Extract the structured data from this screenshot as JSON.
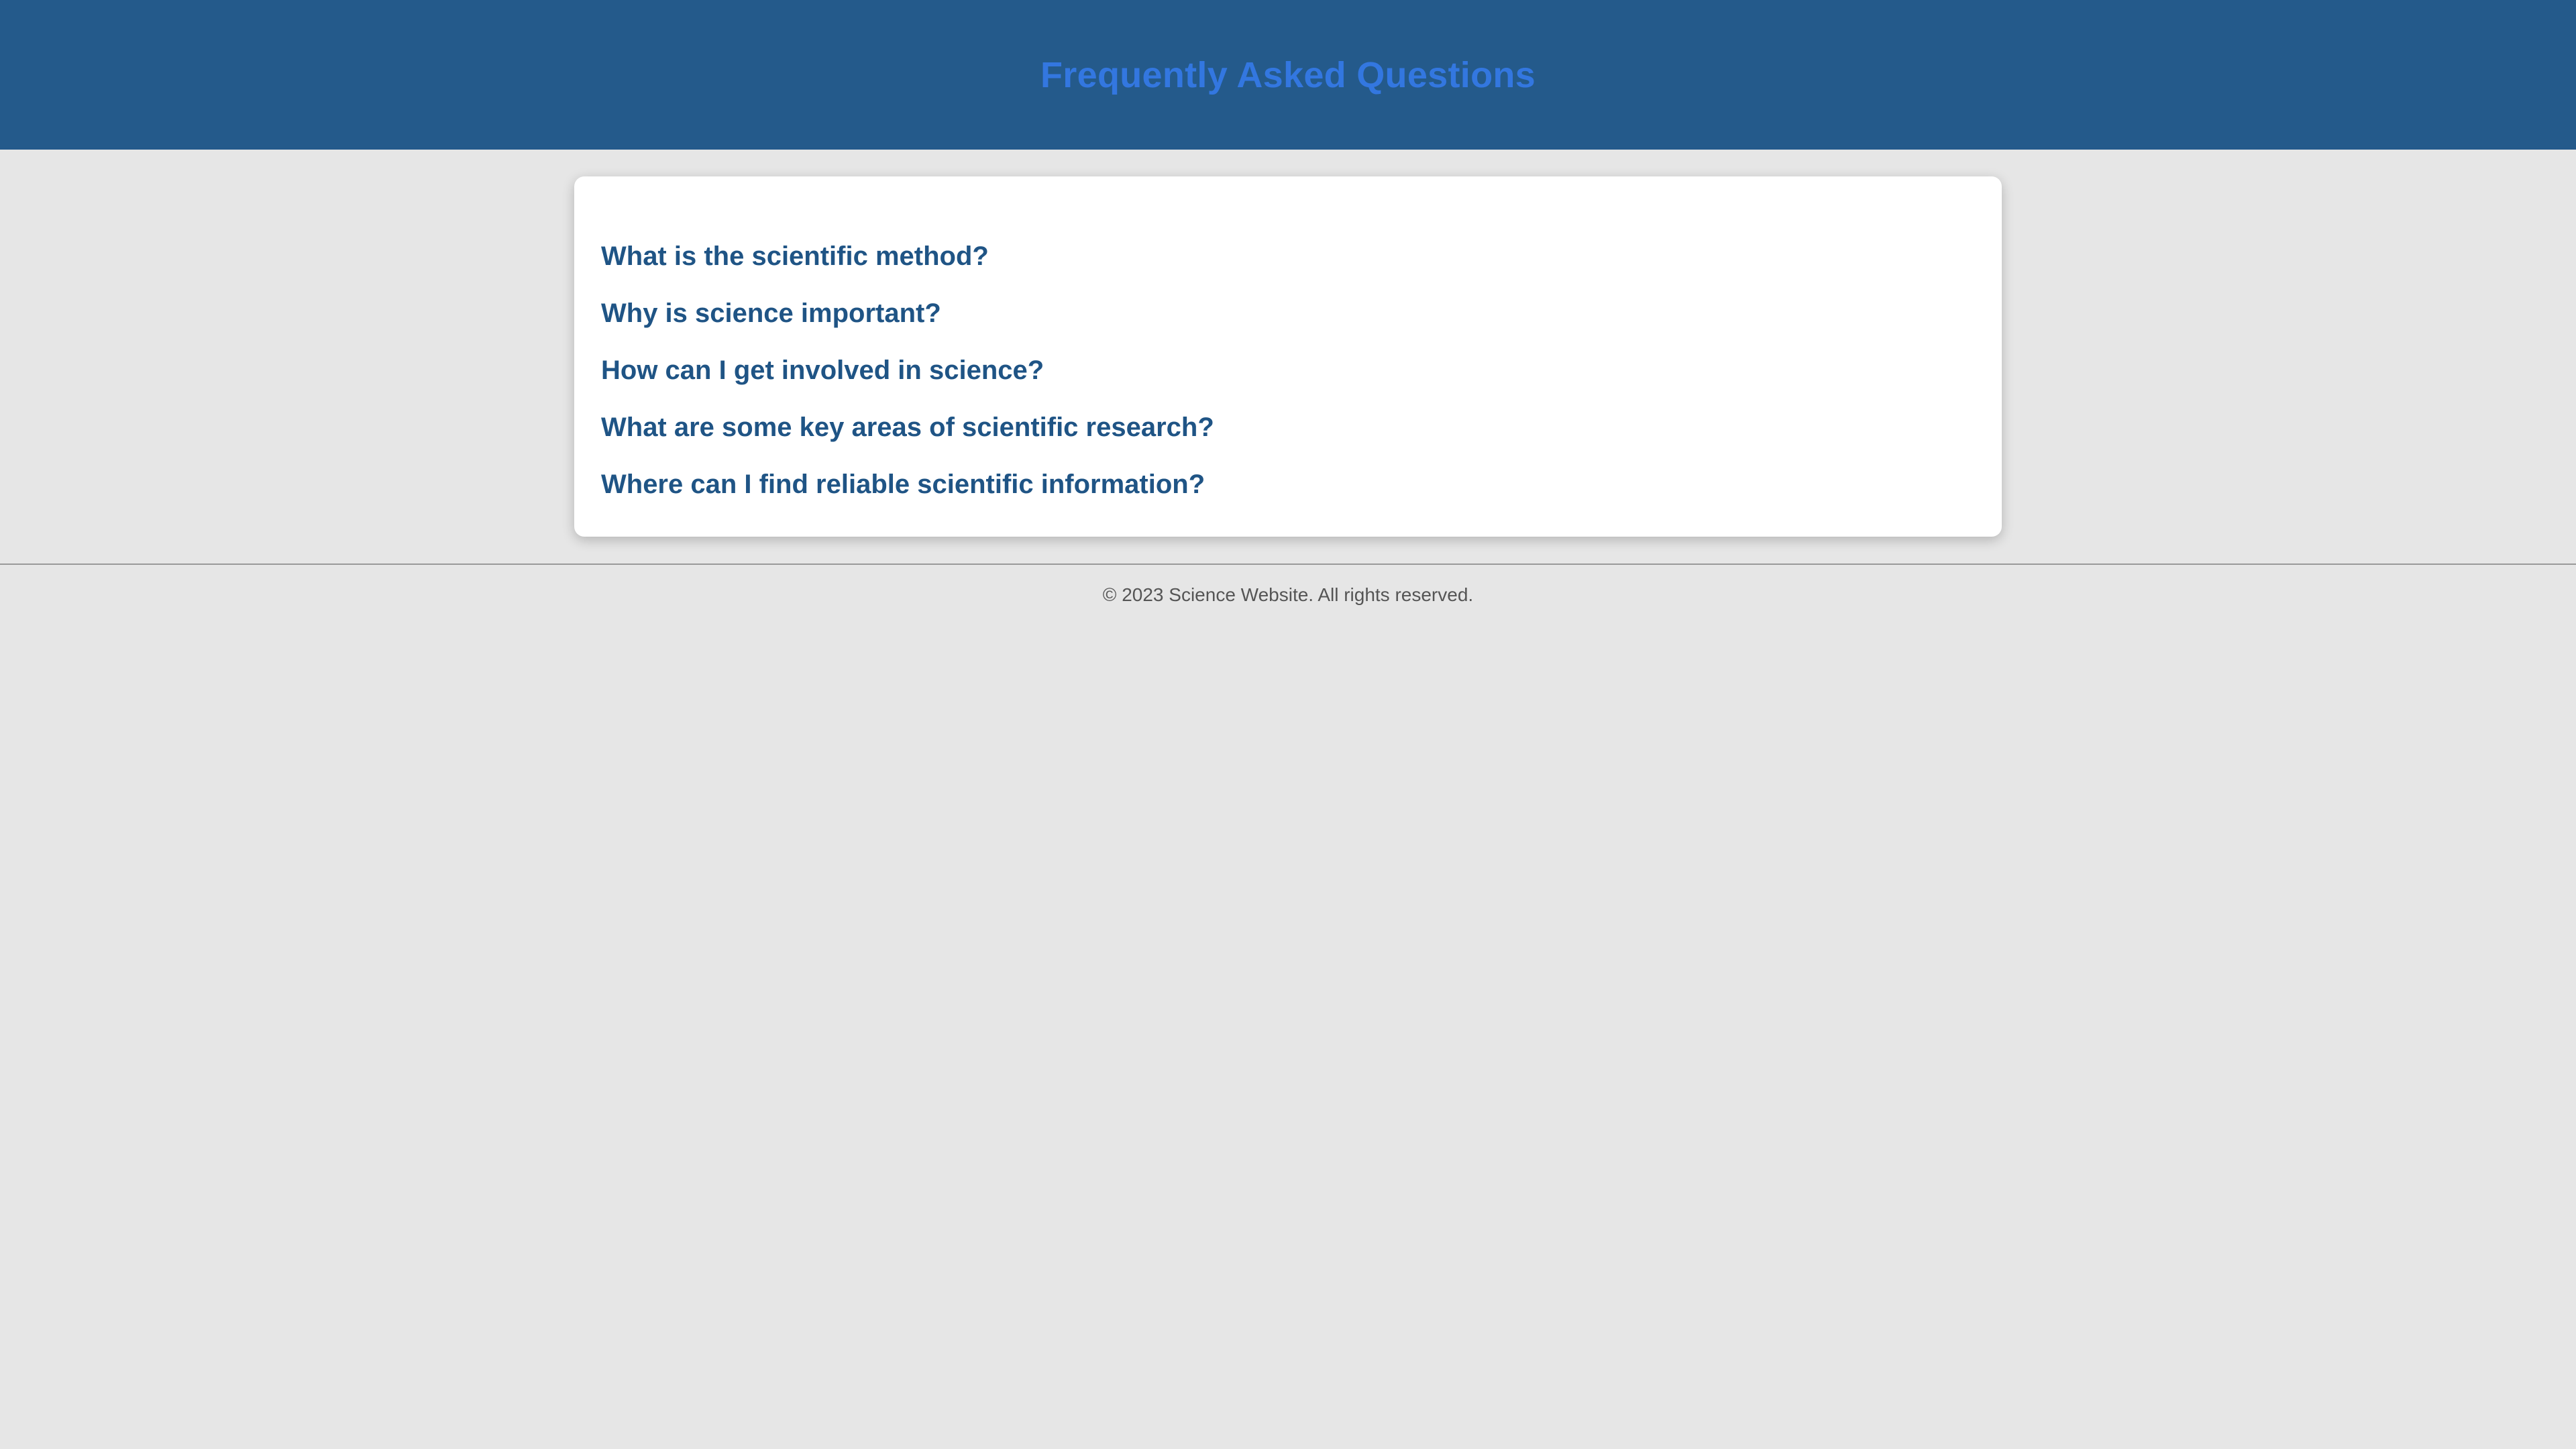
{
  "header": {
    "title": "Frequently Asked Questions"
  },
  "faq": {
    "questions": [
      "What is the scientific method?",
      "Why is science important?",
      "How can I get involved in science?",
      "What are some key areas of scientific research?",
      "Where can I find reliable scientific information?"
    ]
  },
  "footer": {
    "copyright": "© 2023 Science Website. All rights reserved."
  },
  "colors": {
    "header_background": "#245a8b",
    "title_text": "#3377e0",
    "question_text": "#1f5485",
    "page_background": "#e6e6e6",
    "card_background": "#ffffff"
  }
}
